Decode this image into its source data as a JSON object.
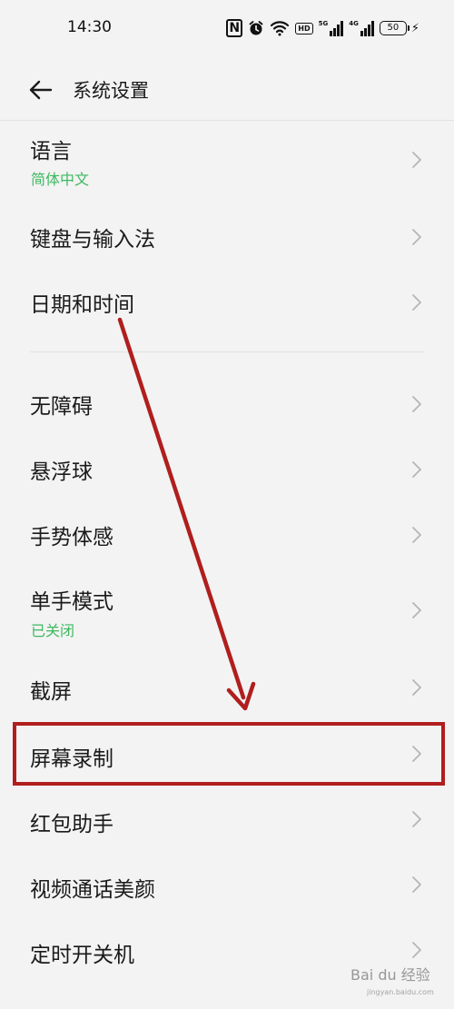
{
  "status_bar": {
    "time": "14:30",
    "nfc": "N",
    "hd": "HD",
    "signal1": "5G",
    "signal2": "4G",
    "battery": "50",
    "icons": [
      "nfc-icon",
      "alarm-icon",
      "wifi-icon",
      "hd-icon",
      "signal-5g-icon",
      "signal-4g-icon",
      "battery-icon",
      "charging-icon"
    ]
  },
  "header": {
    "title": "系统设置",
    "back_icon": "back-arrow-icon"
  },
  "items": [
    {
      "label": "语言",
      "sub": "简体中文"
    },
    {
      "label": "键盘与输入法"
    },
    {
      "label": "日期和时间"
    },
    {
      "label": "无障碍"
    },
    {
      "label": "悬浮球"
    },
    {
      "label": "手势体感"
    },
    {
      "label": "单手模式",
      "sub": "已关闭"
    },
    {
      "label": "截屏"
    },
    {
      "label": "屏幕录制"
    },
    {
      "label": "红包助手"
    },
    {
      "label": "视频通话美颜"
    },
    {
      "label": "定时开关机"
    }
  ],
  "colors": {
    "accent_green": "#3db860",
    "annotation_red": "#b01e1e",
    "background": "#f3f3f3"
  },
  "watermark": {
    "text": "Bai du 经验",
    "url": "jingyan.baidu.com"
  }
}
